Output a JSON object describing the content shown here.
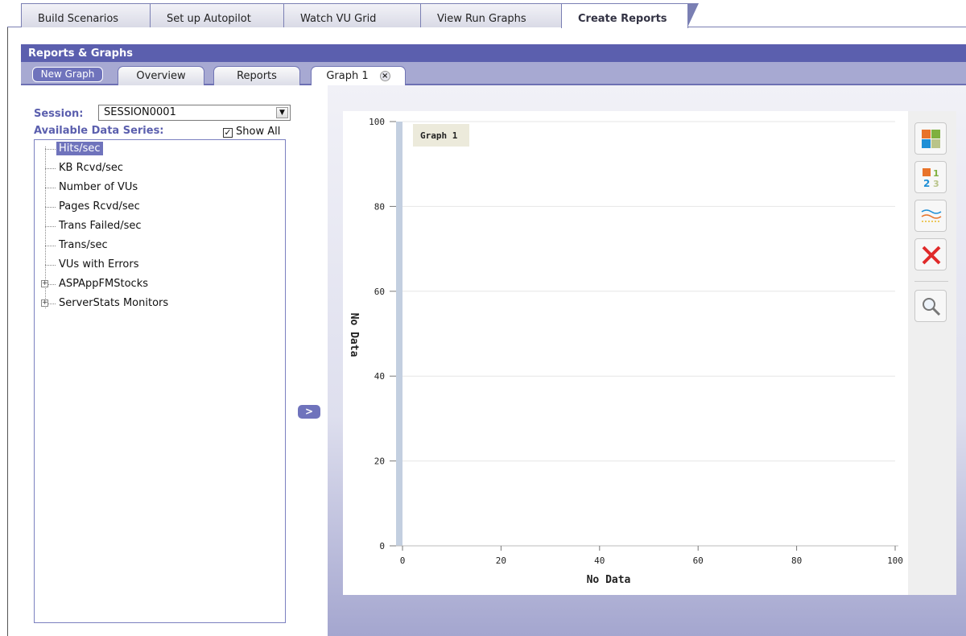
{
  "top_tabs": [
    {
      "label": "Build Scenarios"
    },
    {
      "label": "Set up Autopilot"
    },
    {
      "label": "Watch VU Grid"
    },
    {
      "label": "View Run Graphs"
    },
    {
      "label": "Create Reports"
    }
  ],
  "panel": {
    "title": "Reports & Graphs",
    "new_graph_label": "New Graph",
    "sub_tabs": [
      {
        "label": "Overview"
      },
      {
        "label": "Reports"
      },
      {
        "label": "Graph 1"
      }
    ]
  },
  "session": {
    "label": "Session:",
    "value": "SESSION0001"
  },
  "series_panel": {
    "label": "Available Data Series:",
    "show_all_label": "Show All",
    "show_all_checked": true,
    "items": [
      {
        "label": "Hits/sec",
        "selected": true
      },
      {
        "label": "KB Rcvd/sec"
      },
      {
        "label": "Number of VUs"
      },
      {
        "label": "Pages Rcvd/sec"
      },
      {
        "label": "Trans Failed/sec"
      },
      {
        "label": "Trans/sec"
      },
      {
        "label": "VUs with Errors"
      },
      {
        "label": "ASPAppFMStocks",
        "expandable": true
      },
      {
        "label": "ServerStats Monitors",
        "expandable": true
      }
    ]
  },
  "add_button_label": ">",
  "toolbar": [
    "colors-icon",
    "numbering-icon",
    "line-style-icon",
    "delete-icon",
    "zoom-icon"
  ],
  "chart_data": {
    "type": "line",
    "title": "Graph 1",
    "xlabel": "No Data",
    "ylabel": "No Data",
    "xlim": [
      0,
      100
    ],
    "ylim": [
      0,
      100
    ],
    "x_ticks": [
      "0",
      "20",
      "40",
      "60",
      "80",
      "100"
    ],
    "y_ticks": [
      "0",
      "20",
      "40",
      "60",
      "80",
      "100"
    ],
    "series": [],
    "grid": true
  },
  "colors": {
    "accent": "#5b5fae",
    "selection": "#6f73bc"
  }
}
